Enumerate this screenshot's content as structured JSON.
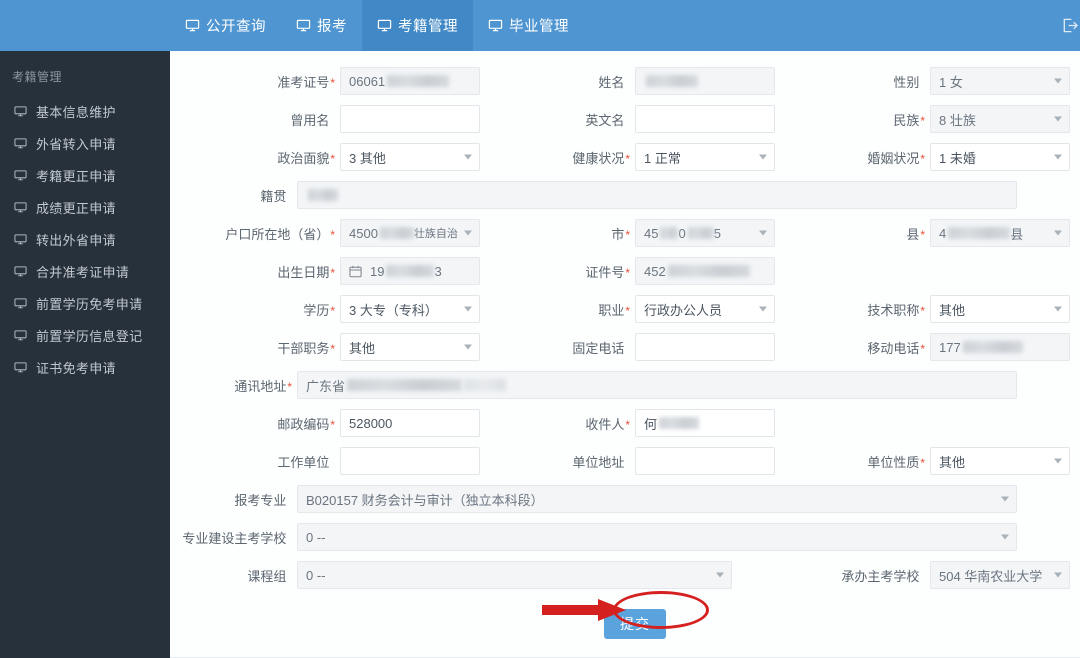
{
  "topnav": {
    "items": [
      {
        "label": "公开查询",
        "icon": "monitor-icon",
        "active": false
      },
      {
        "label": "报考",
        "icon": "monitor-icon",
        "active": false
      },
      {
        "label": "考籍管理",
        "icon": "monitor-icon",
        "active": true
      },
      {
        "label": "毕业管理",
        "icon": "monitor-icon",
        "active": false
      }
    ],
    "logout_icon": "logout-icon"
  },
  "sidebar": {
    "title": "考籍管理",
    "items": [
      {
        "label": "基本信息维护",
        "icon": "monitor-icon"
      },
      {
        "label": "外省转入申请",
        "icon": "monitor-icon"
      },
      {
        "label": "考籍更正申请",
        "icon": "monitor-icon"
      },
      {
        "label": "成绩更正申请",
        "icon": "monitor-icon"
      },
      {
        "label": "转出外省申请",
        "icon": "monitor-icon"
      },
      {
        "label": "合并准考证申请",
        "icon": "monitor-icon"
      },
      {
        "label": "前置学历免考申请",
        "icon": "monitor-icon"
      },
      {
        "label": "前置学历信息登记",
        "icon": "monitor-icon"
      },
      {
        "label": "证书免考申请",
        "icon": "monitor-icon"
      }
    ]
  },
  "form": {
    "admission_number": {
      "label": "准考证号",
      "required": true,
      "value": "06061",
      "redacted": true
    },
    "name": {
      "label": "姓名",
      "required": false,
      "value": "",
      "redacted": true
    },
    "gender": {
      "label": "性别",
      "required": false,
      "value": "1 女"
    },
    "former_name": {
      "label": "曾用名",
      "required": false,
      "value": ""
    },
    "english_name": {
      "label": "英文名",
      "required": false,
      "value": ""
    },
    "ethnicity": {
      "label": "民族",
      "required": true,
      "value": "8 壮族"
    },
    "political_status": {
      "label": "政治面貌",
      "required": true,
      "value": "3 其他"
    },
    "health_status": {
      "label": "健康状况",
      "required": true,
      "value": "1 正常"
    },
    "marital_status": {
      "label": "婚姻状况",
      "required": true,
      "value": "1 未婚"
    },
    "native_place": {
      "label": "籍贯",
      "required": false,
      "value": "",
      "redacted": true
    },
    "household_province": {
      "label": "户口所在地（省）",
      "required": true,
      "value": "4500",
      "value_tail": "壮族自治"
    },
    "household_city": {
      "label": "市",
      "required": true,
      "value": "45",
      "value_mid": "0 ",
      "value_tail": "5"
    },
    "household_county": {
      "label": "县",
      "required": true,
      "value": "4",
      "value_tail": "县"
    },
    "birth_date": {
      "label": "出生日期",
      "required": true,
      "value": "19",
      "value_tail": "3",
      "icon": "calendar-icon"
    },
    "id_number": {
      "label": "证件号",
      "required": true,
      "value": "452",
      "redacted": true
    },
    "education": {
      "label": "学历",
      "required": true,
      "value": "3 大专（专科）"
    },
    "occupation": {
      "label": "职业",
      "required": true,
      "value": "行政办公人员"
    },
    "technical_title": {
      "label": "技术职称",
      "required": true,
      "value": "其他"
    },
    "cadre_position": {
      "label": "干部职务",
      "required": true,
      "value": "其他"
    },
    "landline": {
      "label": "固定电话",
      "required": false,
      "value": ""
    },
    "mobile": {
      "label": "移动电话",
      "required": true,
      "value": "177",
      "redacted": true
    },
    "mailing_address": {
      "label": "通讯地址",
      "required": true,
      "value": "广东省",
      "redacted": true
    },
    "postal_code": {
      "label": "邮政编码",
      "required": true,
      "value": "528000"
    },
    "recipient": {
      "label": "收件人",
      "required": true,
      "value": "何",
      "redacted": true
    },
    "work_unit": {
      "label": "工作单位",
      "required": false,
      "value": ""
    },
    "unit_address": {
      "label": "单位地址",
      "required": false,
      "value": ""
    },
    "unit_nature": {
      "label": "单位性质",
      "required": true,
      "value": "其他"
    },
    "major": {
      "label": "报考专业",
      "required": false,
      "value": "B020157 财务会计与审计（独立本科段）"
    },
    "major_host_school": {
      "label": "专业建设主考学校",
      "required": false,
      "value": "0 --"
    },
    "course_group": {
      "label": "课程组",
      "required": false,
      "value": "0 --"
    },
    "organizing_school": {
      "label": "承办主考学校",
      "required": false,
      "value": "504 华南农业大学"
    }
  },
  "submit": {
    "label": "提交",
    "annotation_color": "#d52020"
  },
  "colors": {
    "header_bg": "#4e95d1",
    "header_active": "#4189c6",
    "sidebar_bg": "#27313c",
    "submit_bg": "#5aa3dd",
    "required_asterisk": "#e8513c"
  }
}
